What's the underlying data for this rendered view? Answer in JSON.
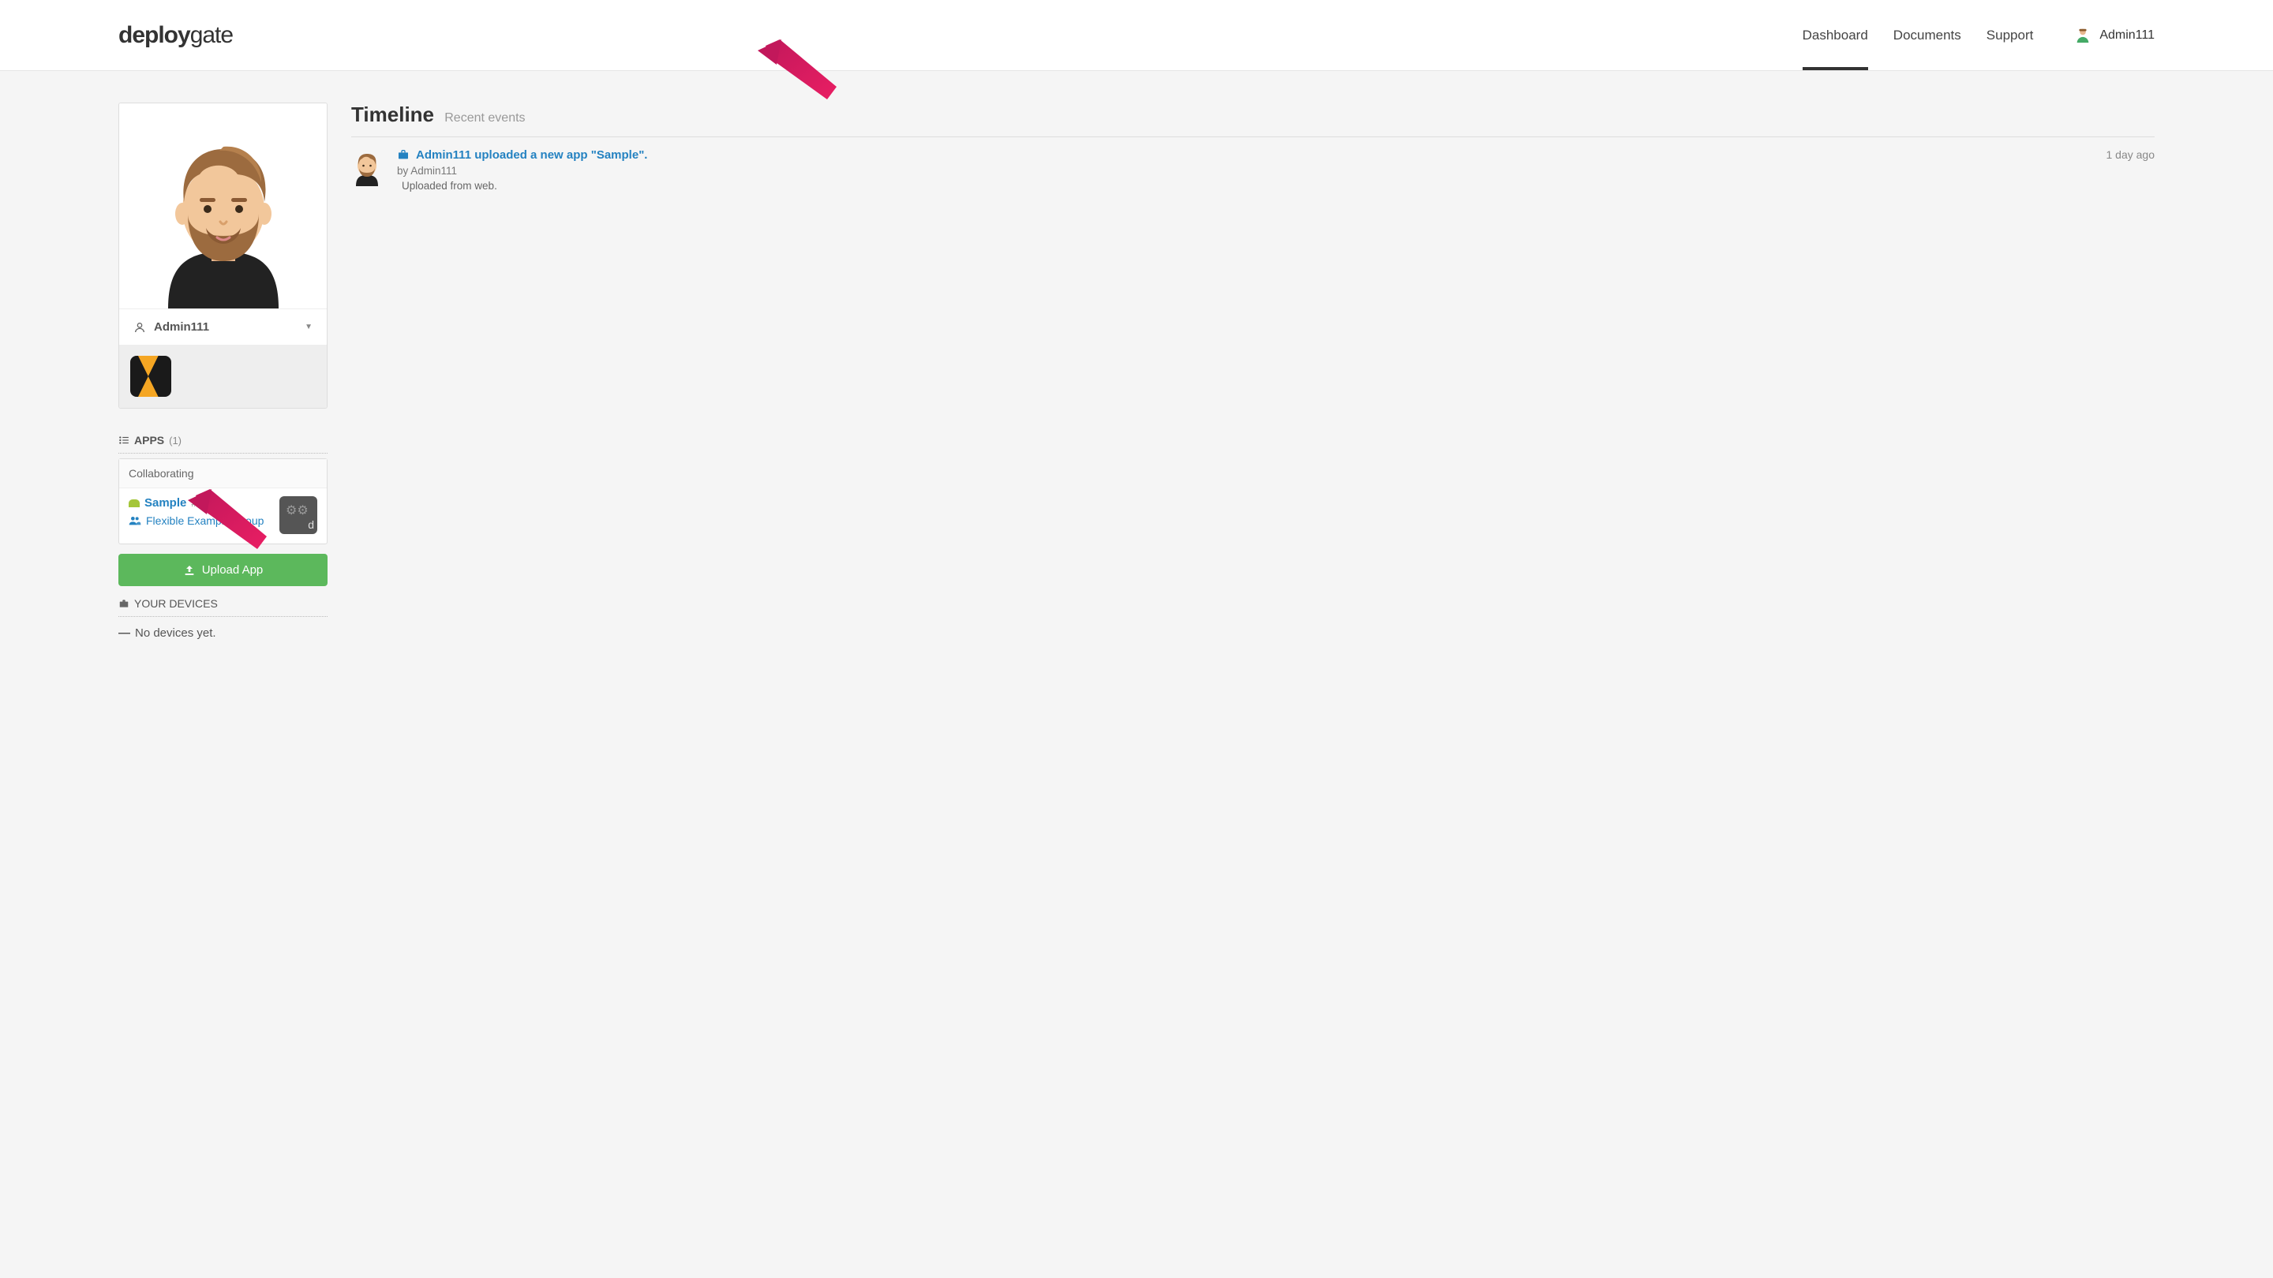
{
  "brand": {
    "part1": "deploy",
    "part2": "gate"
  },
  "nav": {
    "dashboard": "Dashboard",
    "documents": "Documents",
    "support": "Support",
    "user": "Admin111"
  },
  "profile": {
    "name": "Admin111"
  },
  "apps": {
    "section_label": "APPS",
    "count_display": "(1)",
    "group_label": "Collaborating",
    "items": [
      {
        "name": "Sample",
        "revision": "#1",
        "group_link": "Flexible Example Group"
      }
    ]
  },
  "upload_button": "Upload App",
  "devices": {
    "section_label": "YOUR DEVICES",
    "empty_text": "No devices yet."
  },
  "timeline": {
    "title": "Timeline",
    "subtitle": "Recent events",
    "items": [
      {
        "headline": "Admin111 uploaded a new app \"Sample\".",
        "by": "by Admin111",
        "desc": "Uploaded from web.",
        "time": "1 day ago"
      }
    ]
  }
}
